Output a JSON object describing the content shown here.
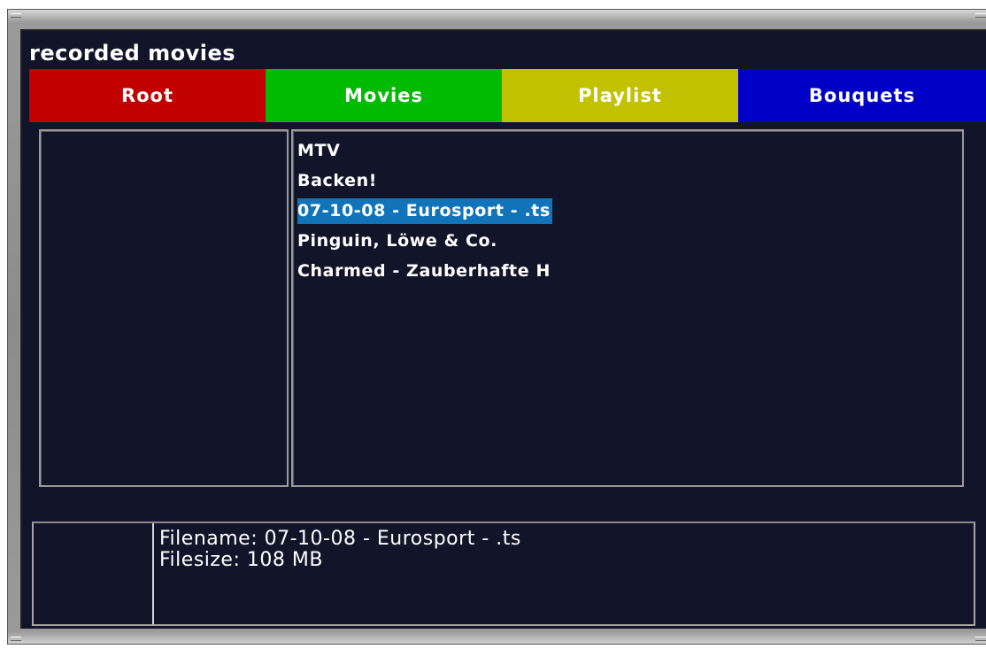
{
  "window": {
    "title": "recorded movies"
  },
  "tabs": [
    {
      "label": "Root",
      "color": "#c30000"
    },
    {
      "label": "Movies",
      "color": "#00bb00"
    },
    {
      "label": "Playlist",
      "color": "#c2c200"
    },
    {
      "label": "Bouquets",
      "color": "#0000c6"
    }
  ],
  "movies": {
    "items": [
      {
        "label": "MTV"
      },
      {
        "label": "Backen!"
      },
      {
        "label": "07-10-08 - Eurosport - .ts",
        "selected": true
      },
      {
        "label": "Pinguin, Löwe & Co."
      },
      {
        "label": "Charmed - Zauberhafte H"
      }
    ],
    "selection_color": "#1274b8"
  },
  "info": {
    "filename_line": "Filename: 07-10-08 - Eurosport - .ts",
    "filesize_line": "Filesize: 108 MB"
  }
}
